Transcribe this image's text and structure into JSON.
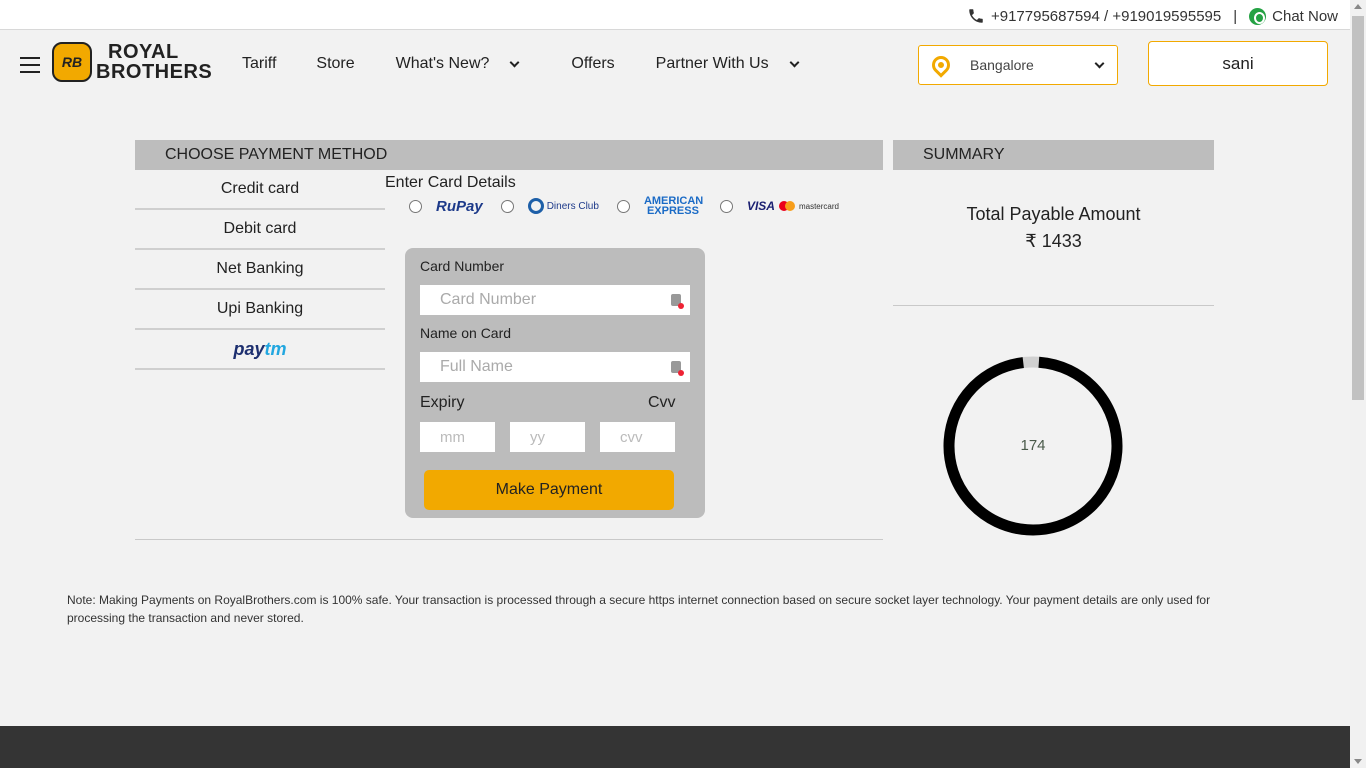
{
  "topbar": {
    "phones": "+917795687594 / +919019595595",
    "separator": "|",
    "chat_label": "Chat Now"
  },
  "header": {
    "logo_line1": "ROYAL",
    "logo_line2": "BROTHERS",
    "logo_badge": "RB",
    "nav": [
      "Tariff",
      "Store",
      "What's New?",
      "Offers",
      "Partner With Us"
    ],
    "city": "Bangalore",
    "user": "sani"
  },
  "payment": {
    "heading": "CHOOSE PAYMENT METHOD",
    "methods": [
      "Credit card",
      "Debit card",
      "Net Banking",
      "Upi Banking"
    ],
    "paytm_label": {
      "pay": "pay",
      "tm": "tm"
    },
    "card_title": "Enter Card Details",
    "brands": {
      "rupay": "RuPay",
      "diners": "Diners Club",
      "amex": "AMERICAN EXPRESS",
      "visa": "VISA",
      "mastercard": "mastercard"
    },
    "form": {
      "card_number_label": "Card Number",
      "card_number_placeholder": "Card Number",
      "name_label": "Name on Card",
      "name_placeholder": "Full Name",
      "expiry_label": "Expiry",
      "cvv_label": "Cvv",
      "mm_placeholder": "mm",
      "yy_placeholder": "yy",
      "cvv_placeholder": "cvv",
      "submit": "Make Payment"
    }
  },
  "summary": {
    "heading": "SUMMARY",
    "total_label": "Total Payable Amount",
    "total_amount": "₹ 1433",
    "timer_value": "174",
    "timer_fraction": 0.97
  },
  "note": "Note: Making Payments on RoyalBrothers.com is 100% safe. Your transaction is processed through a secure https internet connection based on secure socket layer technology. Your payment details are only used for processing the transaction and never stored.",
  "colors": {
    "accent": "#f2a900",
    "panel_gray": "#bdbdbd",
    "footer": "#343434"
  }
}
